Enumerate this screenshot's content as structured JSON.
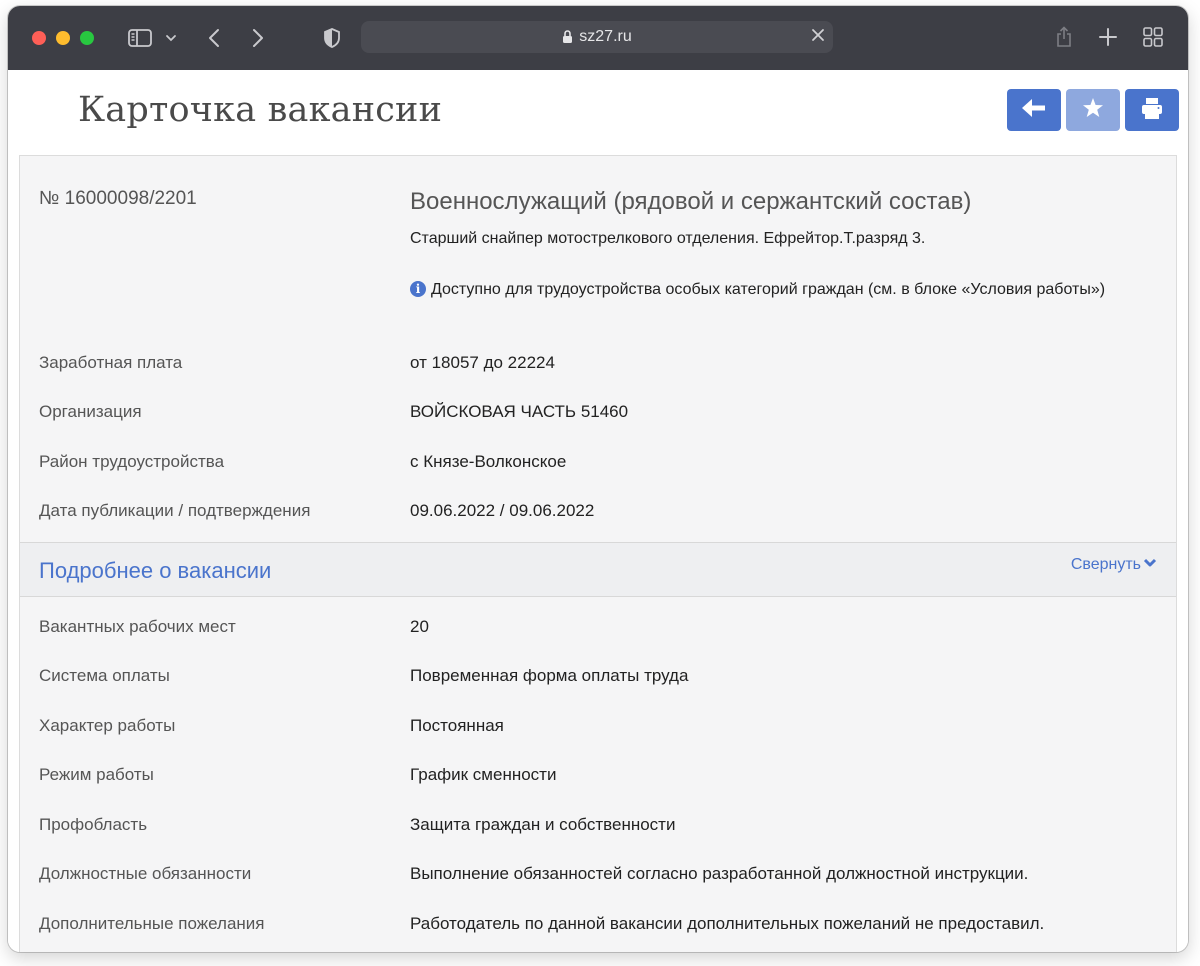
{
  "browser": {
    "url": "sz27.ru",
    "icons": {
      "sidebar": "sidebar-icon",
      "back": "chevron-left-icon",
      "forward": "chevron-right-icon",
      "privacy": "shield-icon",
      "lock": "lock-icon",
      "clear": "close-icon",
      "share": "share-icon",
      "new_tab": "plus-icon",
      "tabs": "grid-icon"
    }
  },
  "header": {
    "title": "Карточка вакансии",
    "actions": [
      {
        "name": "back",
        "icon": "arrow-left-icon"
      },
      {
        "name": "favorite",
        "icon": "star-icon"
      },
      {
        "name": "print",
        "icon": "print-icon"
      }
    ]
  },
  "vacancy": {
    "number": "№ 16000098/2201",
    "title": "Военнослужащий (рядовой и сержантский состав)",
    "subtitle": "Старший снайпер мотострелкового отделения. Ефрейтор.Т.разряд 3.",
    "note": "Доступно для трудоустройства особых категорий граждан (см. в блоке «Условия работы»)",
    "fields": [
      {
        "label": "Заработная плата",
        "value": "от 18057 до 22224"
      },
      {
        "label": "Организация",
        "value": "ВОЙСКОВАЯ ЧАСТЬ 51460"
      },
      {
        "label": "Район трудоустройства",
        "value": "с Князе-Волконское"
      },
      {
        "label": "Дата публикации / подтверждения",
        "value": "09.06.2022 / 09.06.2022"
      }
    ]
  },
  "details": {
    "title": "Подробнее о вакансии",
    "collapse_label": "Свернуть",
    "fields": [
      {
        "label": "Вакантных рабочих мест",
        "value": "20"
      },
      {
        "label": "Система оплаты",
        "value": "Повременная форма оплаты труда"
      },
      {
        "label": "Характер работы",
        "value": "Постоянная"
      },
      {
        "label": "Режим работы",
        "value": "График сменности"
      },
      {
        "label": "Профобласть",
        "value": "Защита граждан и собственности"
      },
      {
        "label": "Должностные обязанности",
        "value": "Выполнение обязанностей согласно разработанной должностной инструкции."
      },
      {
        "label": "Дополнительные пожелания",
        "value": "Работодатель по данной вакансии дополнительных пожеланий не предоставил."
      }
    ]
  },
  "colors": {
    "accent": "#4a74cc",
    "accent_muted": "#8ea8de",
    "toolbar": "#3d3e45",
    "card_bg": "#f5f5f6"
  }
}
